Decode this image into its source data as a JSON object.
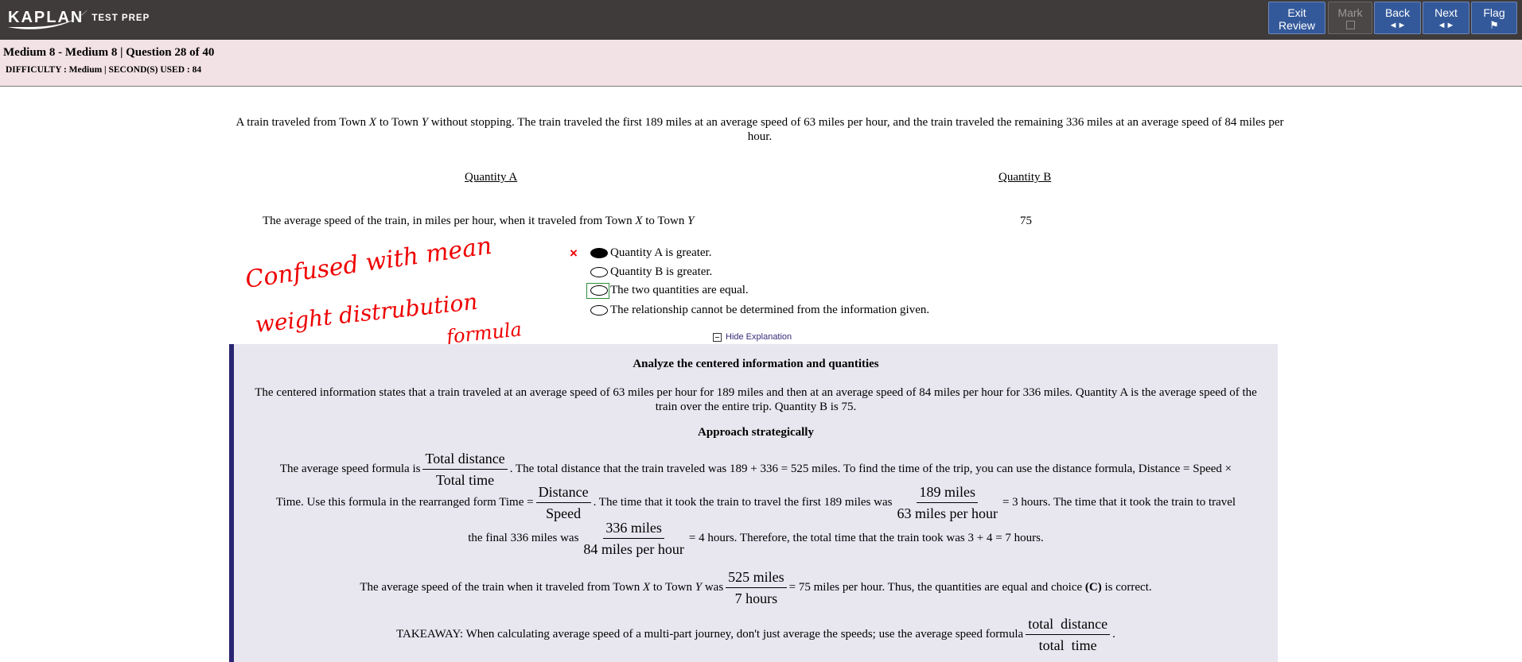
{
  "brand": {
    "logo": "KAPLAN",
    "tagline": "TEST PREP"
  },
  "toolbar": {
    "exit_review": [
      "Exit",
      "Review"
    ],
    "mark": "Mark",
    "back": "Back",
    "back_arrow": "◄►",
    "next": "Next",
    "next_arrow": "◄►",
    "flag": "Flag",
    "flag_icon": "⚑"
  },
  "header": {
    "title": "Medium 8 - Medium 8 | Question  28 of 40",
    "meta": "DIFFICULTY : Medium | SECOND(S) USED : 84"
  },
  "question": {
    "stem_1": "A train traveled from Town ",
    "var_x": "X",
    "stem_2": " to Town ",
    "var_y": "Y",
    "stem_3": " without stopping. The train traveled the first 189 miles at an average speed of 63 miles per hour, and the train traveled the remaining 336 miles at an average speed of 84 miles per hour.",
    "quantity_a_label": "Quantity A",
    "quantity_b_label": "Quantity B",
    "quantity_a_text_1": "The average speed of the train, in miles per hour, when it traveled from Town ",
    "quantity_a_text_2": " to Town ",
    "quantity_b_value": "75"
  },
  "choices": [
    {
      "label": "Quantity A is greater.",
      "selected": true
    },
    {
      "label": "Quantity B is greater.",
      "selected": false
    },
    {
      "label": "The two quantities are equal.",
      "selected": false,
      "focused": true
    },
    {
      "label": "The relationship cannot be determined from the information given.",
      "selected": false
    }
  ],
  "incorrect_mark": "×",
  "annotation": {
    "line1": "Confused with mean",
    "line2": "weight distrubution",
    "line3": "formula",
    "color": "#ee0000"
  },
  "explanation_toggle": "Hide Explanation",
  "explanation": {
    "h1": "Analyze the centered information and quantities",
    "p1": "The centered information states that a train traveled at an average speed of 63 miles per hour for 189 miles and then at an average speed of 84 miles per hour for 336 miles. Quantity A is the average speed of the train over the entire trip. Quantity B is 75.",
    "h2": "Approach strategically",
    "l1_a": "The average speed formula is",
    "l1_num": "Total distance",
    "l1_den": "Total time",
    "l1_b": ". The total distance that the train traveled was 189 + 336 = 525 miles. To find the time of the trip, you can use the distance formula, Distance = Speed ×",
    "l2_a": "Time. Use this formula in the rearranged form Time =",
    "l2_num1": "Distance",
    "l2_den1": "Speed",
    "l2_b": ". The time that it took the train to travel the first 189 miles was",
    "l2_num2": "189 miles",
    "l2_den2": "63 miles per hour",
    "l2_c": "= 3 hours. The time that it took the train to travel",
    "l3_a": "the final 336 miles was",
    "l3_num": "336 miles",
    "l3_den": "84 miles per hour",
    "l3_b": "= 4 hours. Therefore, the total time that the train took was 3 + 4 = 7 hours.",
    "l4_a": "The average speed of the train when it traveled from Town ",
    "l4_b": " to Town ",
    "l4_c": " was",
    "l4_num": "525 miles",
    "l4_den": "7 hours",
    "l4_d": "= 75 miles per hour. Thus, the quantities are equal and choice ",
    "l4_choice": "(C)",
    "l4_e": " is correct.",
    "l5_a": "TAKEAWAY: When calculating average speed of a multi-part journey, don't just average the speeds; use the average speed formula",
    "l5_num": "total  distance",
    "l5_den": "total  time",
    "l5_b": "."
  }
}
